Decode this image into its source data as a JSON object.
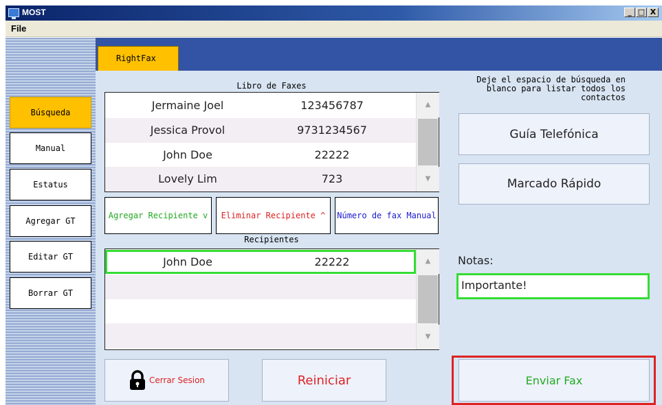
{
  "window": {
    "title": "MOST",
    "controls": [
      "_",
      "□",
      "X"
    ]
  },
  "menu": {
    "file": "File"
  },
  "tabs": {
    "rightfax": "RightFax"
  },
  "sidebar": {
    "items": [
      {
        "label": "Búsqueda"
      },
      {
        "label": "Manual"
      },
      {
        "label": "Estatus"
      },
      {
        "label": "Agregar GT"
      },
      {
        "label": "Editar GT"
      },
      {
        "label": "Borrar GT"
      }
    ],
    "active_index": 0
  },
  "fax_book": {
    "title": "Libro de Faxes",
    "rows": [
      {
        "name": "Jermaine Joel",
        "number": "123456787"
      },
      {
        "name": "Jessica Provol",
        "number": "9731234567"
      },
      {
        "name": "John Doe",
        "number": "22222"
      },
      {
        "name": "Lovely Lim",
        "number": "723"
      }
    ]
  },
  "actions": {
    "add_recipient": "Agregar Recipiente v",
    "remove_recipient": "Eliminar Recipiente ^",
    "manual_fax_number": "Número de fax Manual"
  },
  "recipients": {
    "title": "Recipientes",
    "rows": [
      {
        "name": "John Doe",
        "number": "22222"
      }
    ]
  },
  "help_text": "Deje el espacio de búsqueda en blanco para listar todos los contactos",
  "buttons": {
    "phone_guide": "Guía Telefónica",
    "speed_dial": "Marcado Rápido",
    "logout": "Cerrar Sesion",
    "reset": "Reiniciar",
    "send_fax": "Enviar Fax"
  },
  "notes": {
    "label": "Notas:",
    "value": "Importante!"
  },
  "colors": {
    "accent_orange": "#ffc000",
    "highlight_green": "#33dd33",
    "highlight_red": "#dd2222",
    "add_text": "#22aa22",
    "remove_text": "#dd2222",
    "manual_text": "#1a1ad0",
    "header_blue": "#3354a4"
  }
}
